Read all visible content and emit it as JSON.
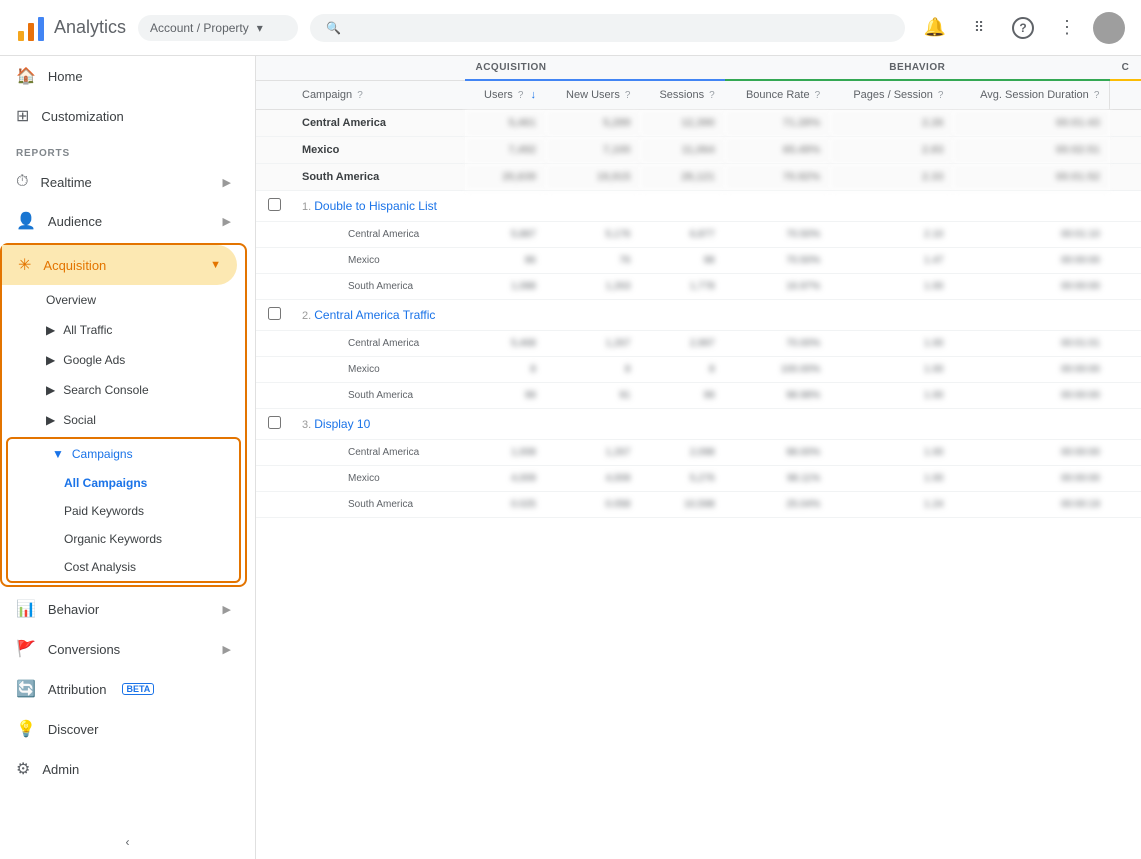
{
  "app": {
    "title": "Analytics",
    "logo_colors": [
      "#f4a61d",
      "#e8710a",
      "#4285f4"
    ]
  },
  "topbar": {
    "account_placeholder": "Account / Property",
    "search_placeholder": "",
    "bell_icon": "🔔",
    "grid_icon": "⋮⋮",
    "help_icon": "?",
    "more_icon": "⋮"
  },
  "sidebar": {
    "home_label": "Home",
    "customization_label": "Customization",
    "reports_label": "REPORTS",
    "realtime_label": "Realtime",
    "audience_label": "Audience",
    "acquisition_label": "Acquisition",
    "overview_label": "Overview",
    "all_traffic_label": "All Traffic",
    "google_ads_label": "Google Ads",
    "search_console_label": "Search Console",
    "social_label": "Social",
    "campaigns_label": "Campaigns",
    "all_campaigns_label": "All Campaigns",
    "paid_keywords_label": "Paid Keywords",
    "organic_keywords_label": "Organic Keywords",
    "cost_analysis_label": "Cost Analysis",
    "behavior_label": "Behavior",
    "conversions_label": "Conversions",
    "attribution_label": "Attribution",
    "attribution_badge": "BETA",
    "discover_label": "Discover",
    "admin_label": "Admin",
    "collapse_icon": "‹"
  },
  "table": {
    "col_checkbox": "",
    "col_campaign": "Campaign",
    "col_help": "?",
    "group_acquisition": "Acquisition",
    "group_behavior": "Behavior",
    "group_conversion": "C",
    "col_users": "Users",
    "col_new_users": "New Users",
    "col_sessions": "Sessions",
    "col_bounce_rate": "Bounce Rate",
    "col_pages_session": "Pages / Session",
    "col_avg_session": "Avg. Session Duration",
    "rows": [
      {
        "type": "summary",
        "num": "",
        "campaign": "Central America",
        "users": "5,461",
        "new_users": "5,289",
        "sessions": "12,390",
        "bounce_rate": "71.28%",
        "pages_session": "2.26",
        "avg_session": "00:01:43"
      },
      {
        "type": "summary",
        "num": "",
        "campaign": "Mexico",
        "users": "7,492",
        "new_users": "7,100",
        "sessions": "11,064",
        "bounce_rate": "65.49%",
        "pages_session": "2.83",
        "avg_session": "00:02:51"
      },
      {
        "type": "summary",
        "num": "",
        "campaign": "South America",
        "users": "20,639",
        "new_users": "19,915",
        "sessions": "28,121",
        "bounce_rate": "70.92%",
        "pages_session": "2.33",
        "avg_session": "00:01:52"
      },
      {
        "type": "campaign",
        "num": "1",
        "campaign": "Double to Hispanic List",
        "users": "",
        "new_users": "",
        "sessions": "",
        "bounce_rate": "",
        "pages_session": "",
        "avg_session": ""
      },
      {
        "type": "region",
        "num": "",
        "campaign": "Central America",
        "users": "5,887",
        "new_users": "5,176",
        "sessions": "6,877",
        "bounce_rate": "70.50%",
        "pages_session": "2.10",
        "avg_session": "00:01:10"
      },
      {
        "type": "region",
        "num": "",
        "campaign": "Mexico",
        "users": "86",
        "new_users": "76",
        "sessions": "98",
        "bounce_rate": "70.50%",
        "pages_session": "1.47",
        "avg_session": "00:00:00"
      },
      {
        "type": "region",
        "num": "",
        "campaign": "South America",
        "users": "1,088",
        "new_users": "1,263",
        "sessions": "1,778",
        "bounce_rate": "16.97%",
        "pages_session": "1.00",
        "avg_session": "00:00:00"
      },
      {
        "type": "campaign",
        "num": "2",
        "campaign": "Central America Traffic",
        "users": "",
        "new_users": "",
        "sessions": "",
        "bounce_rate": "",
        "pages_session": "",
        "avg_session": ""
      },
      {
        "type": "region",
        "num": "",
        "campaign": "Central America",
        "users": "5,468",
        "new_users": "1,267",
        "sessions": "2,997",
        "bounce_rate": "70.00%",
        "pages_session": "1.00",
        "avg_session": "00:01:01"
      },
      {
        "type": "region",
        "num": "",
        "campaign": "Mexico",
        "users": "8",
        "new_users": "8",
        "sessions": "8",
        "bounce_rate": "100.00%",
        "pages_session": "1.00",
        "avg_session": "00:00:00"
      },
      {
        "type": "region",
        "num": "",
        "campaign": "South America",
        "users": "99",
        "new_users": "91",
        "sessions": "99",
        "bounce_rate": "98.98%",
        "pages_session": "1.00",
        "avg_session": "00:00:00"
      },
      {
        "type": "campaign",
        "num": "3",
        "campaign": "Display 10",
        "users": "",
        "new_users": "",
        "sessions": "",
        "bounce_rate": "",
        "pages_session": "",
        "avg_session": ""
      },
      {
        "type": "region",
        "num": "",
        "campaign": "Central America",
        "users": "1,008",
        "new_users": "1,267",
        "sessions": "2,098",
        "bounce_rate": "98.00%",
        "pages_session": "1.00",
        "avg_session": "00:00:00"
      },
      {
        "type": "region",
        "num": "",
        "campaign": "Mexico",
        "users": "4,009",
        "new_users": "4,009",
        "sessions": "5,276",
        "bounce_rate": "98.11%",
        "pages_session": "1.00",
        "avg_session": "00:00:00"
      },
      {
        "type": "region",
        "num": "",
        "campaign": "South America",
        "users": "0.025",
        "new_users": "0.058",
        "sessions": "10,598",
        "bounce_rate": "25.04%",
        "pages_session": "1.24",
        "avg_session": "00:00:19"
      }
    ]
  }
}
